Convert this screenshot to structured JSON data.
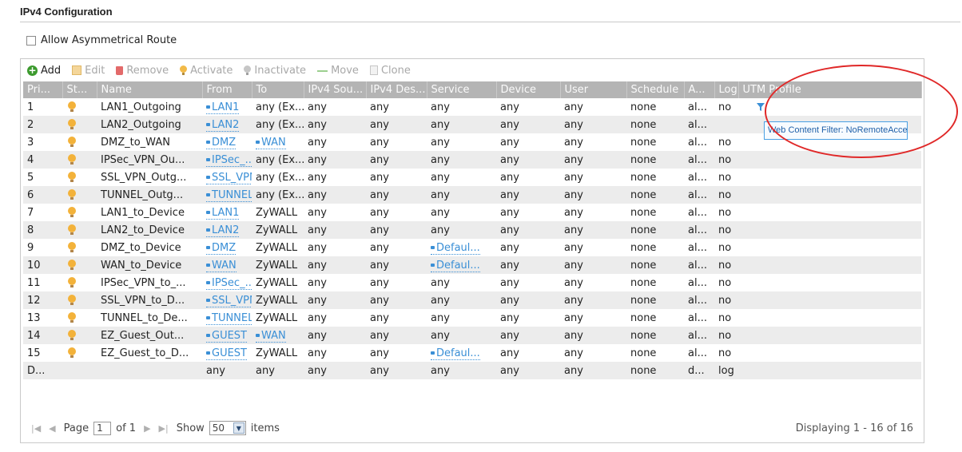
{
  "page": {
    "title": "IPv4 Configuration",
    "asymmetrical_label": "Allow Asymmetrical Route"
  },
  "toolbar": {
    "add": "Add",
    "edit": "Edit",
    "remove": "Remove",
    "activate": "Activate",
    "inactivate": "Inactivate",
    "move": "Move",
    "clone": "Clone"
  },
  "table": {
    "headers": [
      "Pri...",
      "St...",
      "Name",
      "From",
      "To",
      "IPv4 Sou...",
      "IPv4 Des...",
      "Service",
      "Device",
      "User",
      "Schedule",
      "A...",
      "Log",
      "UTM Profile"
    ],
    "rows": [
      {
        "pri": "1",
        "name": "LAN1_Outgoing",
        "from": "LAN1",
        "to": "any (Ex...",
        "src": "any",
        "dst": "any",
        "service": "any",
        "device": "any",
        "user": "any",
        "schedule": "none",
        "action": "al...",
        "log": "no",
        "utm": "filter-icon"
      },
      {
        "pri": "2",
        "name": "LAN2_Outgoing",
        "from": "LAN2",
        "to": "any (Ex...",
        "src": "any",
        "dst": "any",
        "service": "any",
        "device": "any",
        "user": "any",
        "schedule": "none",
        "action": "al...",
        "log": "",
        "utm": ""
      },
      {
        "pri": "3",
        "name": "DMZ_to_WAN",
        "from": "DMZ",
        "to": "WAN",
        "src": "any",
        "dst": "any",
        "service": "any",
        "device": "any",
        "user": "any",
        "schedule": "none",
        "action": "al...",
        "log": "no",
        "utm": ""
      },
      {
        "pri": "4",
        "name": "IPSec_VPN_Ou...",
        "from": "IPSec_...",
        "to": "any (Ex...",
        "src": "any",
        "dst": "any",
        "service": "any",
        "device": "any",
        "user": "any",
        "schedule": "none",
        "action": "al...",
        "log": "no",
        "utm": ""
      },
      {
        "pri": "5",
        "name": "SSL_VPN_Outg...",
        "from": "SSL_VPN",
        "to": "any (Ex...",
        "src": "any",
        "dst": "any",
        "service": "any",
        "device": "any",
        "user": "any",
        "schedule": "none",
        "action": "al...",
        "log": "no",
        "utm": ""
      },
      {
        "pri": "6",
        "name": "TUNNEL_Outg...",
        "from": "TUNNEL",
        "to": "any (Ex...",
        "src": "any",
        "dst": "any",
        "service": "any",
        "device": "any",
        "user": "any",
        "schedule": "none",
        "action": "al...",
        "log": "no",
        "utm": ""
      },
      {
        "pri": "7",
        "name": "LAN1_to_Device",
        "from": "LAN1",
        "to": "ZyWALL",
        "src": "any",
        "dst": "any",
        "service": "any",
        "device": "any",
        "user": "any",
        "schedule": "none",
        "action": "al...",
        "log": "no",
        "utm": ""
      },
      {
        "pri": "8",
        "name": "LAN2_to_Device",
        "from": "LAN2",
        "to": "ZyWALL",
        "src": "any",
        "dst": "any",
        "service": "any",
        "device": "any",
        "user": "any",
        "schedule": "none",
        "action": "al...",
        "log": "no",
        "utm": ""
      },
      {
        "pri": "9",
        "name": "DMZ_to_Device",
        "from": "DMZ",
        "to": "ZyWALL",
        "src": "any",
        "dst": "any",
        "service": "Defaul...",
        "device": "any",
        "user": "any",
        "schedule": "none",
        "action": "al...",
        "log": "no",
        "utm": ""
      },
      {
        "pri": "10",
        "name": "WAN_to_Device",
        "from": "WAN",
        "to": "ZyWALL",
        "src": "any",
        "dst": "any",
        "service": "Defaul...",
        "device": "any",
        "user": "any",
        "schedule": "none",
        "action": "al...",
        "log": "no",
        "utm": ""
      },
      {
        "pri": "11",
        "name": "IPSec_VPN_to_...",
        "from": "IPSec_...",
        "to": "ZyWALL",
        "src": "any",
        "dst": "any",
        "service": "any",
        "device": "any",
        "user": "any",
        "schedule": "none",
        "action": "al...",
        "log": "no",
        "utm": ""
      },
      {
        "pri": "12",
        "name": "SSL_VPN_to_D...",
        "from": "SSL_VPN",
        "to": "ZyWALL",
        "src": "any",
        "dst": "any",
        "service": "any",
        "device": "any",
        "user": "any",
        "schedule": "none",
        "action": "al...",
        "log": "no",
        "utm": ""
      },
      {
        "pri": "13",
        "name": "TUNNEL_to_De...",
        "from": "TUNNEL",
        "to": "ZyWALL",
        "src": "any",
        "dst": "any",
        "service": "any",
        "device": "any",
        "user": "any",
        "schedule": "none",
        "action": "al...",
        "log": "no",
        "utm": ""
      },
      {
        "pri": "14",
        "name": "EZ_Guest_Out...",
        "from": "GUEST",
        "to": "WAN",
        "src": "any",
        "dst": "any",
        "service": "any",
        "device": "any",
        "user": "any",
        "schedule": "none",
        "action": "al...",
        "log": "no",
        "utm": ""
      },
      {
        "pri": "15",
        "name": "EZ_Guest_to_D...",
        "from": "GUEST",
        "to": "ZyWALL",
        "src": "any",
        "dst": "any",
        "service": "Defaul...",
        "device": "any",
        "user": "any",
        "schedule": "none",
        "action": "al...",
        "log": "no",
        "utm": ""
      },
      {
        "pri": "D...",
        "name": "",
        "from": "any",
        "to": "any",
        "src": "any",
        "dst": "any",
        "service": "any",
        "device": "any",
        "user": "any",
        "schedule": "none",
        "action": "d...",
        "log": "log",
        "utm": ""
      }
    ]
  },
  "tooltip": {
    "text": "Web Content Filter: NoRemoteAcces"
  },
  "pager": {
    "page_label": "Page",
    "page_value": "1",
    "of_label": "of 1",
    "show_label": "Show",
    "show_value": "50",
    "items_label": "items",
    "display_text": "Displaying 1 - 16 of 16"
  },
  "colors": {
    "header_bg": "#b4b4b4",
    "row_alt": "#ececec",
    "link": "#3a8fd6",
    "highlight_circle": "#e02828"
  }
}
